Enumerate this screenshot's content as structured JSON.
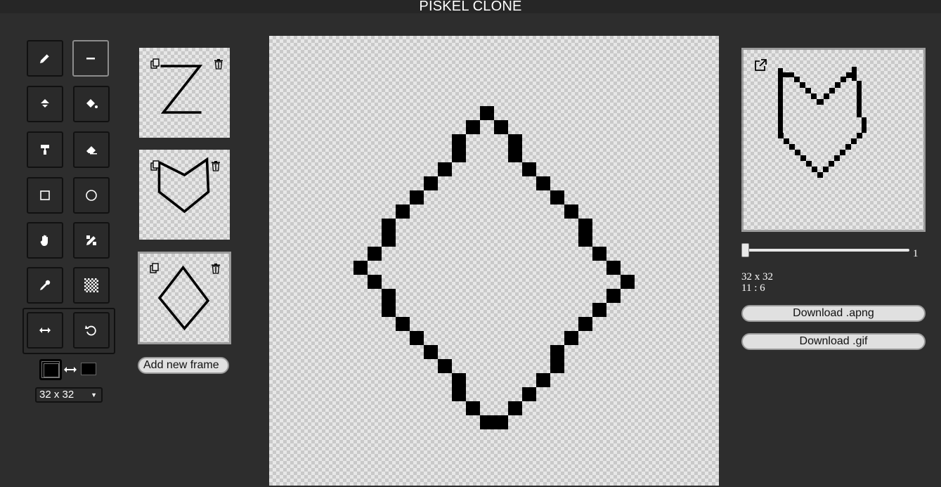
{
  "app": {
    "title": "PISKEL CLONE"
  },
  "tools": [
    {
      "name": "pen",
      "icon": "pencil-icon",
      "active": false
    },
    {
      "name": "stroke",
      "icon": "line-icon",
      "active": true
    },
    {
      "name": "paint-bucket",
      "icon": "paint-bucket-icon",
      "active": false
    },
    {
      "name": "paint-all-same-color",
      "icon": "paint-bucket-fill-icon",
      "active": false
    },
    {
      "name": "lighten",
      "icon": "paint-roller-icon",
      "active": false
    },
    {
      "name": "eraser",
      "icon": "eraser-icon",
      "active": false
    },
    {
      "name": "rectangle",
      "icon": "square-icon",
      "active": false
    },
    {
      "name": "circle",
      "icon": "circle-icon",
      "active": false
    },
    {
      "name": "move",
      "icon": "hand-icon",
      "active": false
    },
    {
      "name": "dithering",
      "icon": "pen-ruler-icon",
      "active": false
    },
    {
      "name": "color-picker",
      "icon": "eyedropper-icon",
      "active": false
    },
    {
      "name": "checkerboard",
      "icon": "checkerboard-icon",
      "active": false
    },
    {
      "name": "flip",
      "icon": "horizontal-arrows-icon",
      "active": false
    },
    {
      "name": "rotate",
      "icon": "rotate-icon",
      "active": false
    }
  ],
  "colors": {
    "primary": "#000000",
    "secondary": "#000000"
  },
  "canvas_size_select": {
    "value": "32 x 32"
  },
  "frames": [
    {
      "label": "frame-1",
      "shape": "Z"
    },
    {
      "label": "frame-2",
      "shape": "heart"
    },
    {
      "label": "frame-3",
      "shape": "diamond",
      "active": true
    }
  ],
  "add_frame_label": "Add new frame",
  "preview": {
    "fps_value": "1",
    "size": "32 x 32",
    "cursor": "11 : 6",
    "download_apng": "Download .apng",
    "download_gif": "Download .gif"
  }
}
